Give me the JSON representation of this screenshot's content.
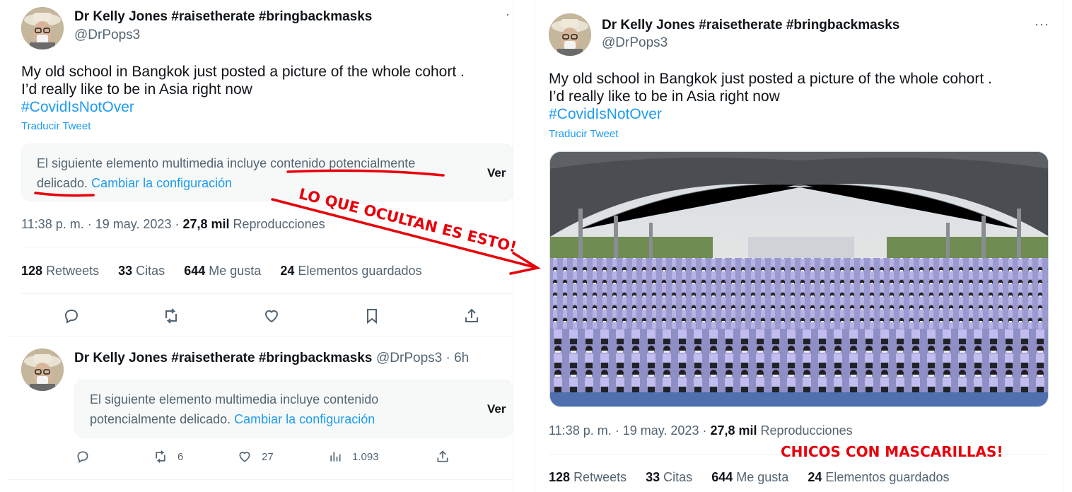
{
  "author": {
    "name": "Dr Kelly Jones #raisetherate #bringbackmasks",
    "handle": "@DrPops3"
  },
  "tweet": {
    "line1": "My old school in Bangkok just posted a picture of the whole cohort .",
    "line2": "I’d really like to be in Asia right now",
    "hashtag": "#CovidIsNotOver",
    "translate": "Traducir Tweet",
    "more": "···"
  },
  "sensitive": {
    "text": "El siguiente elemento multimedia incluye contenido potencialmente delicado.",
    "text_part1": "El siguiente elemento multimedia incluye contenido potencialmente",
    "text_part2": "delicado.",
    "link": "Cambiar la configuración",
    "view": "Ver",
    "reply_text_part1": "El siguiente elemento multimedia incluye contenido",
    "reply_text_part2": "potencialmente delicado."
  },
  "meta": {
    "time": "11:38 p. m. · 19 may. 2023 · ",
    "views_count": "27,8 mil",
    "views_label": "Reproducciones"
  },
  "stats": {
    "retweets_count": "128",
    "retweets_label": "Retweets",
    "quotes_count": "33",
    "quotes_label": "Citas",
    "likes_count": "644",
    "likes_label": "Me gusta",
    "bookmarks_count": "24",
    "bookmarks_label": "Elementos guardados"
  },
  "reply": {
    "handle_time": "@DrPops3 · 6h",
    "retweets": "6",
    "likes": "27",
    "views": "1.093"
  },
  "annotations": {
    "arrow_text": "LO QUE OCULTAN ES ESTO!",
    "bottom_text": "CHICOS CON MASCARILLAS!",
    "color": "#e8000b"
  },
  "colors": {
    "link": "#1d9bf0",
    "secondary_text": "#536471",
    "primary_text": "#0f1419"
  }
}
